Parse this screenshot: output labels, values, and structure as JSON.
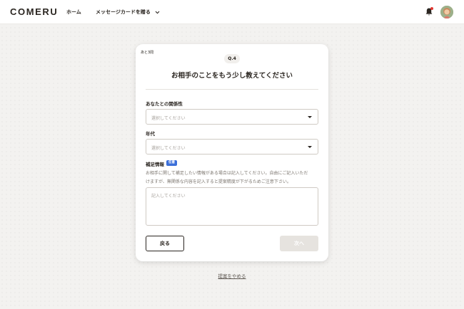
{
  "header": {
    "logo": "COMERU",
    "nav": {
      "home": "ホーム",
      "send_message_card": "メッセージカードを贈る"
    },
    "notification_dot_color": "#e2362f"
  },
  "question_card": {
    "remaining": "あと3問",
    "question_number": "Q.4",
    "title": "お相手のことをもう少し教えてください",
    "relationship": {
      "label": "あなたとの関係性",
      "selected": "選択してください"
    },
    "age_group": {
      "label": "年代",
      "selected": "選択してください"
    },
    "supplement": {
      "label": "補足情報",
      "badge": "任意",
      "note_line1": "お相手に関して補足したい情報がある場合は記入してください。自由にご記入いただ",
      "note_line2": "けますが、無関係な内容を記入すると提案精度が下がるためご注意下さい。",
      "placeholder": "記入してください"
    },
    "back_button": "戻る",
    "next_button": "次へ"
  },
  "quit_link": "提案をやめる",
  "colors": {
    "accent_badge": "#3b6fd9",
    "text_primary": "#2b2621",
    "disabled_button": "#e6e3df"
  }
}
